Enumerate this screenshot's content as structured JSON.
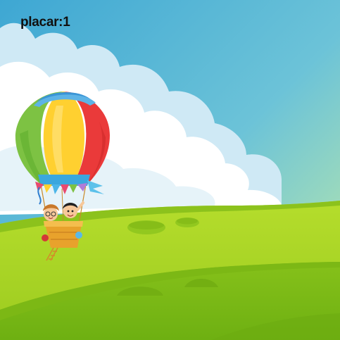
{
  "hud": {
    "score_text": "placar:1"
  },
  "colors": {
    "sky_top": "#4aaed6",
    "sky_right": "#b8e9a4",
    "cloud": "#ffffff",
    "cloud_shade": "#d6eef7",
    "grass_light": "#a6d62b",
    "grass_mid": "#8fc41a",
    "grass_dark": "#76b812",
    "balloon_green": "#7dc243",
    "balloon_yellow": "#ffd030",
    "balloon_red": "#ea3a3a",
    "balloon_blue_top": "#3a95d6",
    "basket": "#e8a22c"
  },
  "icons": [
    "hot-air-balloon-icon"
  ]
}
